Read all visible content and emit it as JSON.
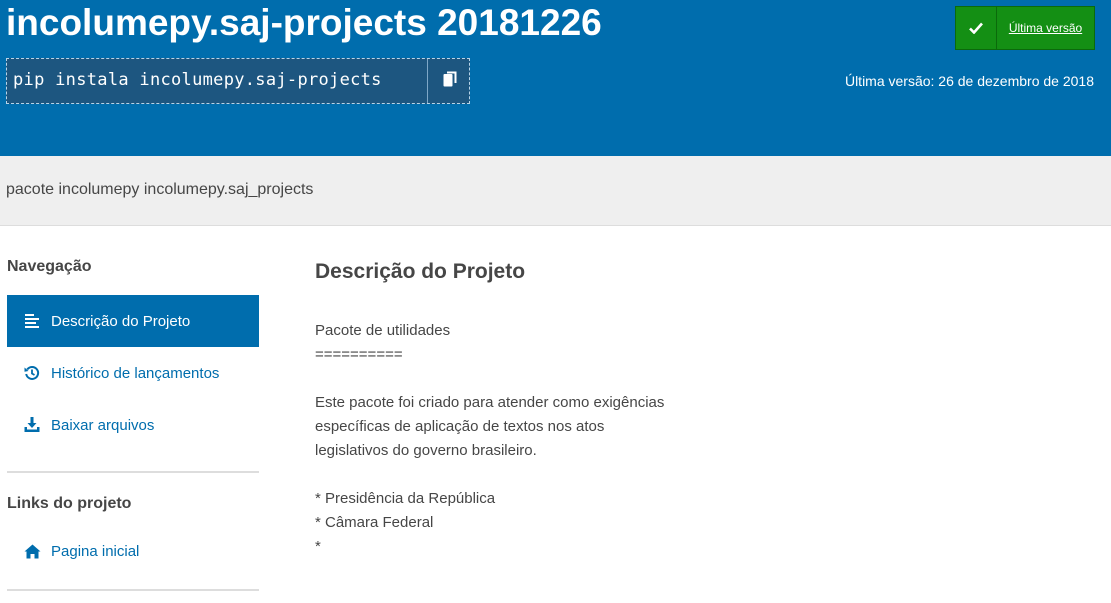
{
  "header": {
    "package_title": "incolumepy.saj-projects 20181226",
    "pip_command": "pip instala incolumepy.saj-projects",
    "copy_icon": "copy-icon",
    "latest_version_label": "Última versão",
    "release_date": "Última versão: 26 de dezembro de 2018"
  },
  "summary": "pacote incolumepy incolumepy.saj_projects",
  "sidebar": {
    "nav_heading": "Navegação",
    "nav_items": [
      {
        "label": "Descrição do Projeto",
        "icon": "align-left-icon",
        "active": true
      },
      {
        "label": "Histórico de lançamentos",
        "icon": "history-icon",
        "active": false
      },
      {
        "label": "Baixar arquivos",
        "icon": "download-icon",
        "active": false
      }
    ],
    "links_heading": "Links do projeto",
    "links": [
      {
        "label": "Pagina inicial",
        "icon": "home-icon"
      }
    ]
  },
  "main": {
    "title": "Descrição do Projeto",
    "description": [
      "Pacote de utilidades",
      "==========",
      "",
      "Este pacote foi criado para atender como exigências",
      "específicas de aplicação de textos nos atos",
      "legislativos do governo brasileiro.",
      "",
      "* Presidência da República",
      "* Câmara Federal",
      "*"
    ]
  },
  "colors": {
    "header_blue": "#006dad",
    "green_button": "#148f14",
    "summary_bg": "#efefef",
    "text": "#464646"
  }
}
